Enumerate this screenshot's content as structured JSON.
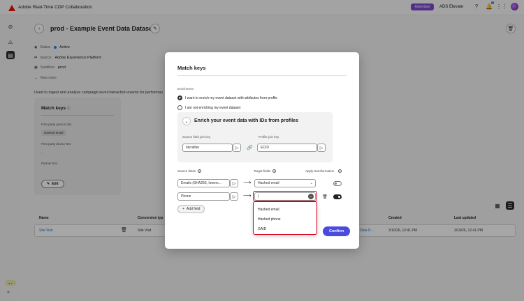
{
  "app": {
    "title": "Adobe Real-Time CDP Collaboration",
    "role_badge": "Advertiser",
    "org_name": "ADS Elevate",
    "notification_count": "1"
  },
  "page": {
    "title": "prod - Example Event Data Dataset",
    "status_label": "Status:",
    "status_value": "Active",
    "source_label": "Source:",
    "source_value": "Adobe Experience Platform",
    "sandbox_label": "Sandbox:",
    "sandbox_value": "prod",
    "view_more": "View more",
    "description": "Used to ingest and analyze campaign-level interaction events for performan"
  },
  "match_keys_card": {
    "title": "Match keys",
    "first_party_person_label": "First-party person IDs",
    "first_party_person_chip": "Hashed email",
    "first_party_device_label": "First-party device IDs",
    "first_party_device_value": "-",
    "partner_label": "Partner IDs",
    "edit_label": "Edit"
  },
  "table": {
    "headers": {
      "name": "Name",
      "conversion_type": "Conversion typ",
      "created": "Created",
      "last_updated": "Last updated"
    },
    "row": {
      "name": "Site Visit",
      "conversion_type": "Site Visit",
      "dataset": "Data D...",
      "created": "3/10/26, 12:41 PM",
      "last_updated": "3/10/26, 12:41 PM"
    }
  },
  "modal": {
    "title": "Match keys",
    "enrichment_label": "Enrichment",
    "radio_enrich": "I want to enrich my event dataset with attributes from profile",
    "radio_not_enrich": "I am not enriching my event dataset",
    "enrich_header": "Enrich your event data with IDs from profiles",
    "source_join_label": "Source field join key",
    "source_join_value": "Identifier",
    "profile_join_label": "Profile join key",
    "profile_join_value": "ECID",
    "source_fields_label": "Source fields",
    "target_fields_label": "Target fields",
    "apply_transform_label": "Apply transformation",
    "rows": [
      {
        "source": "Emails (SHA256, lowerc...",
        "target": "Hashed email"
      },
      {
        "source": "Phone",
        "target": ""
      }
    ],
    "add_field": "Add field",
    "confirm": "Confirm"
  },
  "dropdown": {
    "options": [
      "Hashed email",
      "Hashed phone",
      "GAID"
    ]
  },
  "colors": {
    "accent": "#4b4bde",
    "focus_red": "#d6001c",
    "adobe_red": "#eb1000",
    "badge_purple": "#7e4bd1"
  }
}
